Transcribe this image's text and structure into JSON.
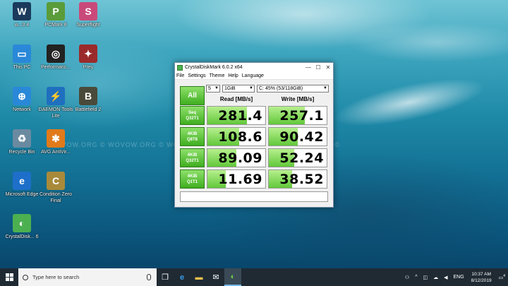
{
  "desktop": {
    "icons": [
      {
        "label": "w...3.4",
        "glyph": "W",
        "color": "#1b3a5c"
      },
      {
        "label": "PCMark 8",
        "glyph": "P",
        "color": "#5a9b3a"
      },
      {
        "label": "Superflight",
        "glyph": "S",
        "color": "#c94a7a"
      },
      {
        "label": "This PC",
        "glyph": "▭",
        "color": "#2a88d8"
      },
      {
        "label": "Performanc...",
        "glyph": "◎",
        "color": "#222222"
      },
      {
        "label": "Prey",
        "glyph": "✦",
        "color": "#9b2b2b"
      },
      {
        "label": "Network",
        "glyph": "⊕",
        "color": "#2a88d8"
      },
      {
        "label": "DAEMON Tools Lite",
        "glyph": "⚡",
        "color": "#1f6fbf"
      },
      {
        "label": "Battlefield 2",
        "glyph": "B",
        "color": "#4a4a3a"
      },
      {
        "label": "Recycle Bin",
        "glyph": "♻",
        "color": "#6a8aa0"
      },
      {
        "label": "AVG AntiVir...",
        "glyph": "✱",
        "color": "#e07a1a"
      },
      {
        "label": "Microsoft Edge",
        "glyph": "e",
        "color": "#1d6fc9"
      },
      {
        "label": "Condition Zero Final",
        "glyph": "C",
        "color": "#a88a3a"
      },
      {
        "label": "CrystalDisk... 6",
        "glyph": "◐",
        "color": "#4caf50"
      }
    ],
    "watermark": "WOVOW.ORG © WOVOW.ORG © WOVOW.ORG © WOVOW.ORG © WOVOW.ORG ©"
  },
  "window": {
    "title": "CrystalDiskMark 6.0.2 x64",
    "controls": {
      "minimize": "—",
      "maximize": "☐",
      "close": "✕"
    },
    "menu": [
      "File",
      "Settings",
      "Theme",
      "Help",
      "Language"
    ],
    "all_label": "All",
    "count": "5",
    "size": "1GiB",
    "drive": "C: 45% (53/118GiB)",
    "read_header": "Read [MB/s]",
    "write_header": "Write [MB/s]",
    "rows": [
      {
        "line1": "Seq",
        "line2": "Q32T1",
        "read": "281.4",
        "write": "257.1",
        "read_fill": 0.68,
        "write_fill": 0.62
      },
      {
        "line1": "4KiB",
        "line2": "Q8T8",
        "read": "108.6",
        "write": "90.42",
        "read_fill": 0.55,
        "write_fill": 0.5
      },
      {
        "line1": "4KiB",
        "line2": "Q32T1",
        "read": "89.09",
        "write": "52.24",
        "read_fill": 0.5,
        "write_fill": 0.44
      },
      {
        "line1": "4KiB",
        "line2": "Q1T1",
        "read": "11.69",
        "write": "38.52",
        "read_fill": 0.32,
        "write_fill": 0.4
      }
    ]
  },
  "taskbar": {
    "search_placeholder": "Type here to search",
    "language": "ENG",
    "time": "10:37 AM",
    "date": "8/12/2019",
    "notification_count": "4"
  }
}
